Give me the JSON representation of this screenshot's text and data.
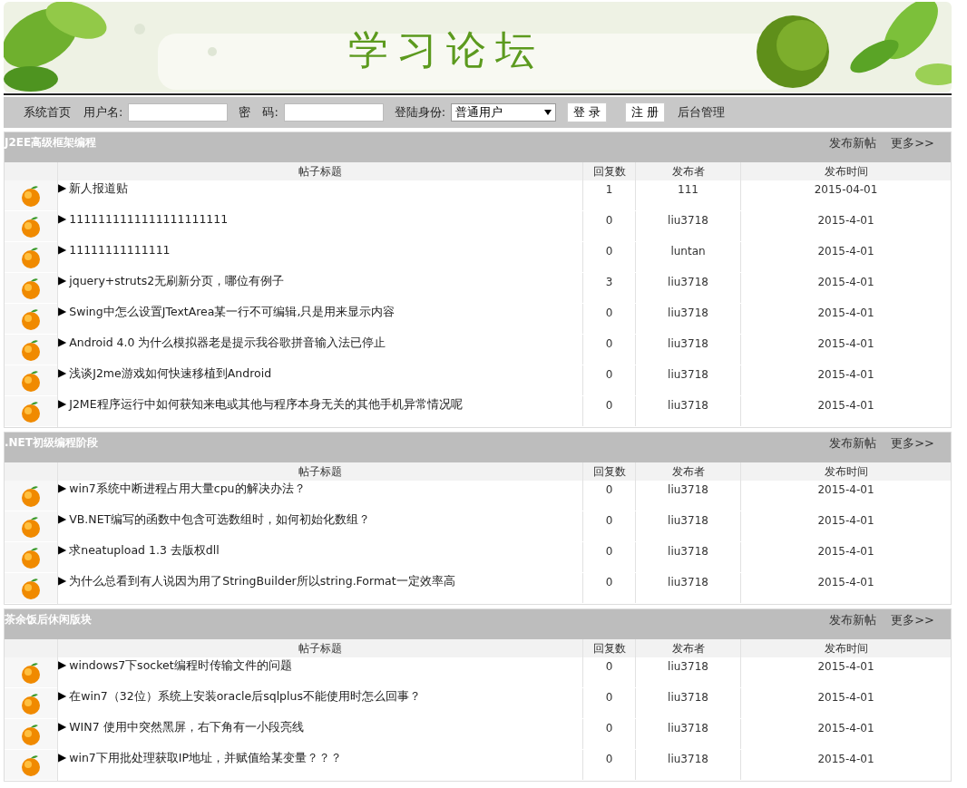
{
  "banner": {
    "title": "学习论坛"
  },
  "nav": {
    "home": "系统首页",
    "username_label": "用户名:",
    "password_label": "密　码:",
    "role_label": "登陆身份:",
    "role_value": "普通用户",
    "login": "登 录",
    "register": "注 册",
    "admin": "后台管理"
  },
  "sections": [
    {
      "title": "J2EE高级框架编程",
      "new_post": "发布新帖",
      "more": "更多>>",
      "columns": [
        "帖子标题",
        "回复数",
        "发布者",
        "发布时间"
      ],
      "rows": [
        {
          "marker": "▶",
          "title": "新人报道贴",
          "replies": "1",
          "author": "111",
          "date": "2015-04-01"
        },
        {
          "marker": "▶",
          "title": "1111111111111111111111",
          "replies": "0",
          "author": "liu3718",
          "date": "2015-4-01"
        },
        {
          "marker": "▶",
          "title": "11111111111111",
          "replies": "0",
          "author": "luntan",
          "date": "2015-4-01"
        },
        {
          "marker": "▶",
          "title": "jquery+struts2无刷新分页，哪位有例子",
          "replies": "3",
          "author": "liu3718",
          "date": "2015-4-01"
        },
        {
          "marker": "▶",
          "title": "Swing中怎么设置JTextArea某一行不可编辑,只是用来显示内容",
          "replies": "0",
          "author": "liu3718",
          "date": "2015-4-01"
        },
        {
          "marker": "▶",
          "title": "Android 4.0 为什么模拟器老是提示我谷歌拼音输入法已停止",
          "replies": "0",
          "author": "liu3718",
          "date": "2015-4-01"
        },
        {
          "marker": "▶",
          "title": "浅谈J2me游戏如何快速移植到Android",
          "replies": "0",
          "author": "liu3718",
          "date": "2015-4-01"
        },
        {
          "marker": "▶",
          "title": "J2ME程序运行中如何获知来电或其他与程序本身无关的其他手机异常情况呢",
          "replies": "0",
          "author": "liu3718",
          "date": "2015-4-01"
        }
      ]
    },
    {
      "title": ".NET初级编程阶段",
      "new_post": "发布新帖",
      "more": "更多>>",
      "columns": [
        "帖子标题",
        "回复数",
        "发布者",
        "发布时间"
      ],
      "rows": [
        {
          "marker": "▶",
          "title": "win7系统中断进程占用大量cpu的解决办法？",
          "replies": "0",
          "author": "liu3718",
          "date": "2015-4-01"
        },
        {
          "marker": "▶",
          "title": "VB.NET编写的函数中包含可选数组时，如何初始化数组？",
          "replies": "0",
          "author": "liu3718",
          "date": "2015-4-01"
        },
        {
          "marker": "▶",
          "title": "求neatupload 1.3 去版权dll",
          "replies": "0",
          "author": "liu3718",
          "date": "2015-4-01"
        },
        {
          "marker": "▶",
          "title": "为什么总看到有人说因为用了StringBuilder所以string.Format一定效率高",
          "replies": "0",
          "author": "liu3718",
          "date": "2015-4-01"
        }
      ]
    },
    {
      "title": "茶余饭后休闲版块",
      "new_post": "发布新帖",
      "more": "更多>>",
      "columns": [
        "帖子标题",
        "回复数",
        "发布者",
        "发布时间"
      ],
      "rows": [
        {
          "marker": "▶",
          "title": "windows7下socket编程时传输文件的问题",
          "replies": "0",
          "author": "liu3718",
          "date": "2015-4-01"
        },
        {
          "marker": "▶",
          "title": "在win7（32位）系统上安装oracle后sqlplus不能使用时怎么回事？",
          "replies": "0",
          "author": "liu3718",
          "date": "2015-4-01"
        },
        {
          "marker": "▶",
          "title": "WIN7 使用中突然黑屏，右下角有一小段亮线",
          "replies": "0",
          "author": "liu3718",
          "date": "2015-4-01"
        },
        {
          "marker": "▶",
          "title": "win7下用批处理获取IP地址，并赋值给某变量？？？",
          "replies": "0",
          "author": "liu3718",
          "date": "2015-4-01"
        }
      ]
    }
  ]
}
